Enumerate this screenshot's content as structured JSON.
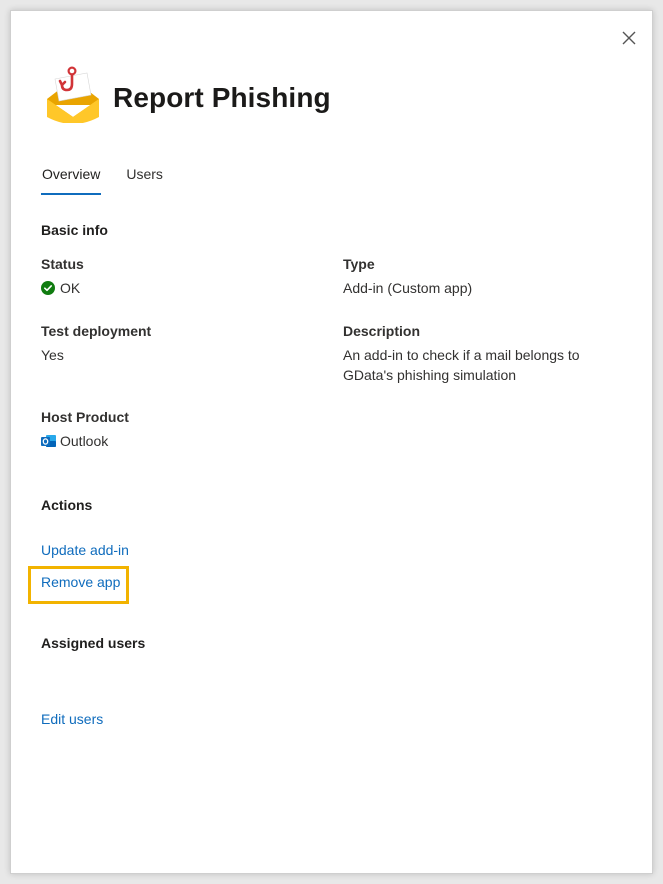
{
  "header": {
    "title": "Report Phishing",
    "logo_icon": "mail-hook-icon",
    "close_icon": "close-icon"
  },
  "tabs": [
    {
      "label": "Overview",
      "active": true
    },
    {
      "label": "Users",
      "active": false
    }
  ],
  "basic_info": {
    "heading": "Basic info",
    "status_label": "Status",
    "status_value": "OK",
    "status_icon": "check-circle-icon",
    "status_color": "#107c10",
    "type_label": "Type",
    "type_value": "Add-in (Custom app)",
    "test_deployment_label": "Test deployment",
    "test_deployment_value": "Yes",
    "description_label": "Description",
    "description_value": "An add-in to check if a mail belongs to GData's phishing simulation",
    "host_product_label": "Host Product",
    "host_product_value": "Outlook",
    "host_product_icon": "outlook-icon"
  },
  "actions": {
    "heading": "Actions",
    "update_label": "Update add-in",
    "remove_label": "Remove app",
    "highlight_color": "#f2b300"
  },
  "assigned_users": {
    "heading": "Assigned users",
    "edit_label": "Edit users"
  },
  "colors": {
    "link": "#0f6cbd",
    "tab_underline": "#0f6cbd"
  }
}
